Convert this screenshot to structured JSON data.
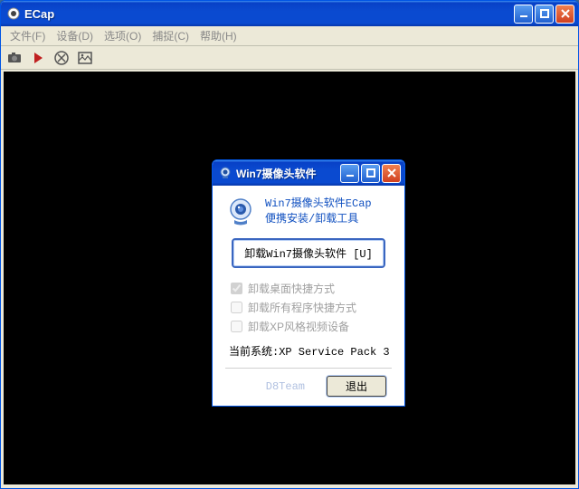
{
  "main": {
    "title": "ECap",
    "menu": {
      "file": "文件(F)",
      "device": "设备(D)",
      "options": "选项(O)",
      "capture": "捕捉(C)",
      "help": "帮助(H)"
    }
  },
  "dialog": {
    "title": "Win7摄像头软件",
    "head1": "Win7摄像头软件ECap",
    "head2": "便携安装/卸载工具",
    "uninstall_btn": "卸载Win7摄像头软件 [U]",
    "chk_desktop": "卸载桌面快捷方式",
    "chk_programs": "卸载所有程序快捷方式",
    "chk_xp": "卸载XP风格视频设备",
    "sys_prefix": "当前系统:",
    "sys_value": "XP Service Pack 3",
    "team": "D8Team",
    "exit": "退出"
  }
}
